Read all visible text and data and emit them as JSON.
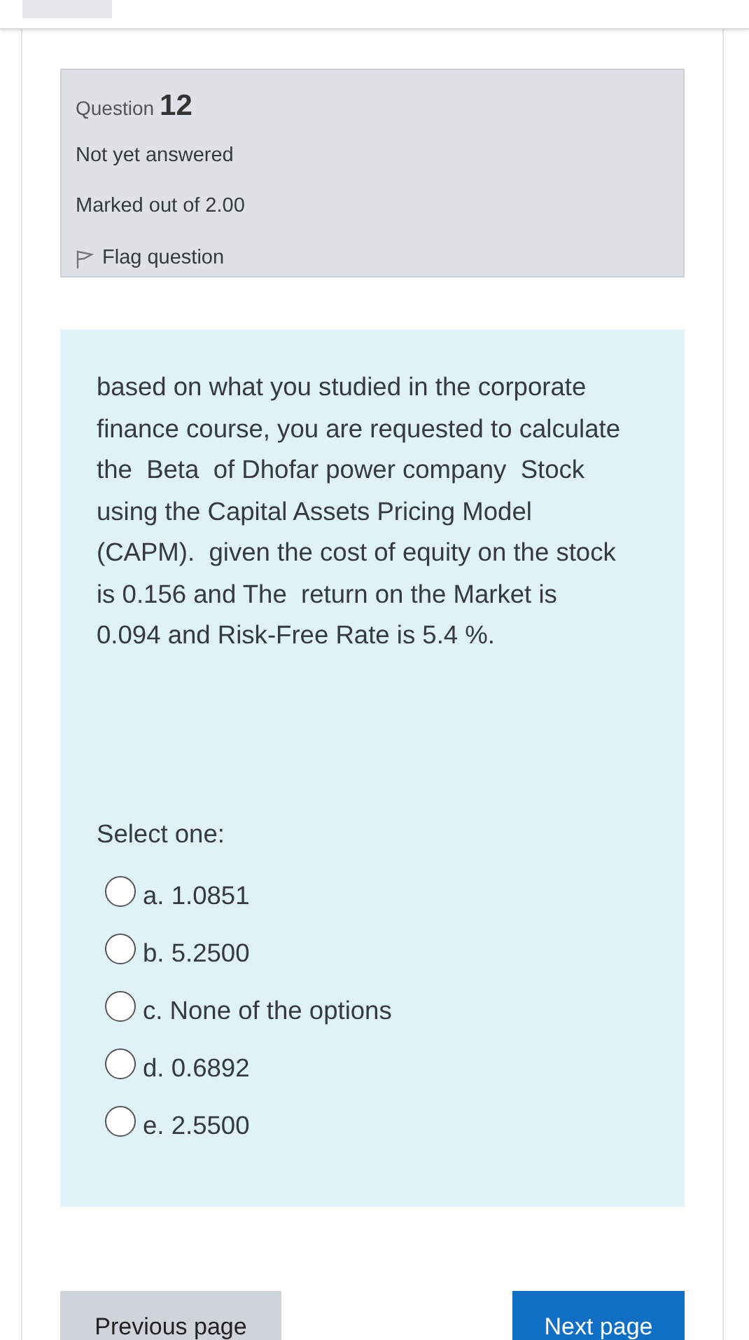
{
  "question_info": {
    "label": "Question",
    "number": "12",
    "status": "Not yet answered",
    "marks": "Marked out of 2.00",
    "flag": {
      "label": "Flag question",
      "flagged": false
    }
  },
  "question": {
    "text": "based on what you studied in the corporate finance course, you are requested to calculate the  Beta  of Dhofar power company  Stock using the Capital Assets Pricing Model (CAPM).  given the cost of equity on the stock is 0.156 and The  return on the Market is 0.094 and Risk-Free Rate is 5.4 %.",
    "prompt": "Select one:",
    "options": [
      {
        "label": "a. 1.0851",
        "selected": false
      },
      {
        "label": "b. 5.2500",
        "selected": false
      },
      {
        "label": "c. None of the options",
        "selected": false
      },
      {
        "label": "d. 0.6892",
        "selected": false
      },
      {
        "label": "e. 2.5500",
        "selected": false
      }
    ]
  },
  "navigation": {
    "previous": "Previous page",
    "next": "Next page"
  }
}
